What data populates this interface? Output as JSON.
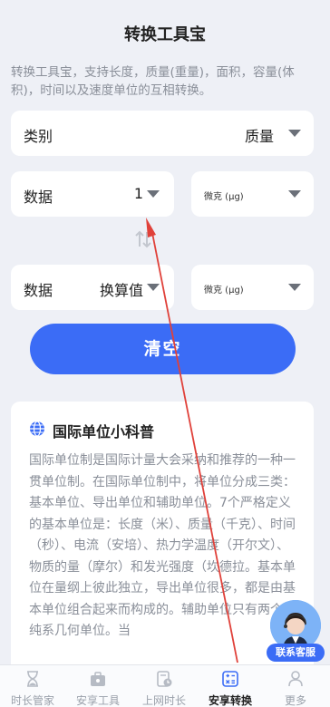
{
  "header": {
    "title": "转换工具宝"
  },
  "intro": "转换工具宝，支持长度，质量(重量)，面积，容量(体积)，时间以及速度单位的互相转换。",
  "category": {
    "label": "类别",
    "value": "质量"
  },
  "input_row": {
    "label": "数据",
    "value": "1",
    "unit": "微克 (μg)"
  },
  "output_row": {
    "label": "数据",
    "value": "换算值",
    "unit": "微克 (μg)"
  },
  "clear_button": "清空",
  "info": {
    "title": "国际单位小科普",
    "body": "国际单位制是国际计量大会采纳和推荐的一种一贯单位制。在国际单位制中，将单位分成三类：基本单位、导出单位和辅助单位。7个严格定义的基本单位是：长度（米）、质量（千克）、时间（秒）、电流（安培）、热力学温度（开尔文）、物质的量（摩尔）和发光强度（坎德拉。基本单位在量纲上彼此独立，导出单位很多，都是由基本单位组合起来而构成的。辅助单位只有两个，纯系几何单位。当"
  },
  "support": {
    "label": "联系客服"
  },
  "tabs": [
    {
      "label": "时长管家",
      "icon": "hourglass-icon"
    },
    {
      "label": "安享工具",
      "icon": "toolbox-icon"
    },
    {
      "label": "上网时长",
      "icon": "clock-doc-icon"
    },
    {
      "label": "安享转换",
      "icon": "calculator-icon",
      "active": true
    },
    {
      "label": "更多",
      "icon": "person-icon"
    }
  ],
  "colors": {
    "accent": "#3b6cf6",
    "annotation_arrow": "#e0413a"
  }
}
